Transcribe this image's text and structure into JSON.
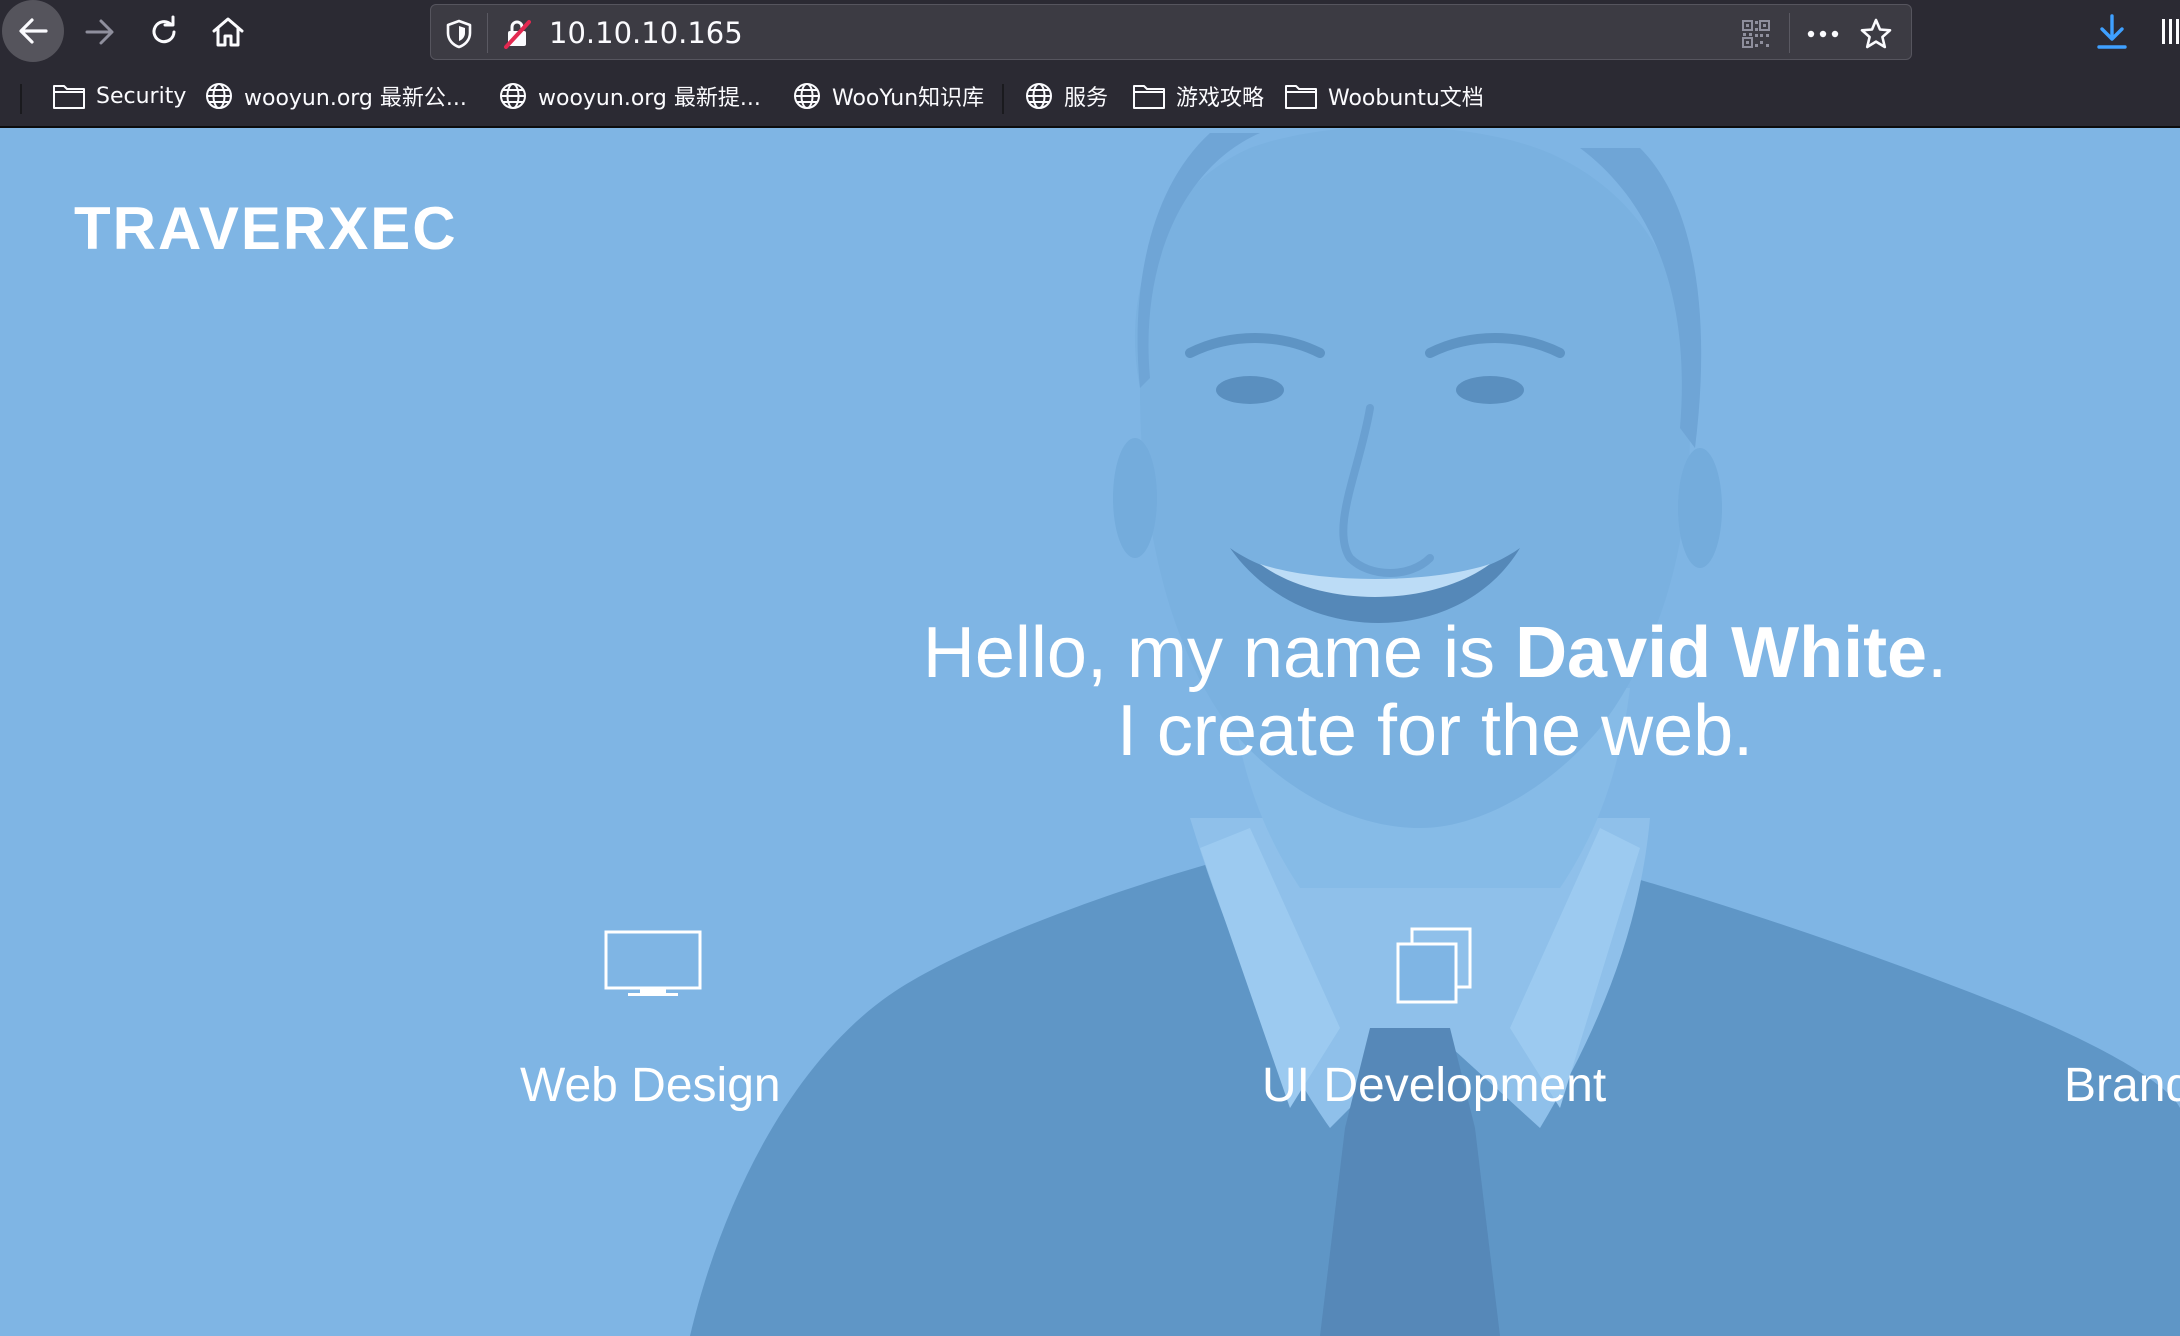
{
  "browser": {
    "url": "10.10.10.165",
    "icons": {
      "back": "back-arrow-icon",
      "forward": "forward-arrow-icon",
      "reload": "reload-icon",
      "home": "home-icon",
      "tracking": "shield-icon",
      "insecure": "insecure-lock-icon",
      "qr": "qr-code-icon",
      "more": "ellipsis-icon",
      "bookmark": "star-icon",
      "downloads": "download-icon",
      "library": "library-icon"
    },
    "bookmarks": [
      {
        "label": "Security",
        "icon": "folder-icon"
      },
      {
        "label": "wooyun.org 最新公...",
        "icon": "globe-icon"
      },
      {
        "label": "wooyun.org 最新提...",
        "icon": "globe-icon"
      },
      {
        "label": "WooYun知识库",
        "icon": "globe-icon"
      },
      {
        "label": "服务",
        "icon": "globe-icon"
      },
      {
        "label": "游戏攻略",
        "icon": "folder-icon"
      },
      {
        "label": "Woobuntu文档",
        "icon": "folder-icon"
      }
    ]
  },
  "site": {
    "brand": "TRAVERXEC",
    "headline": {
      "prefix": "Hello, my name is ",
      "name": "David White",
      "suffix": ".",
      "line2": "I create for the web."
    },
    "services": [
      {
        "label": "Web Design",
        "icon": "monitor-icon"
      },
      {
        "label": "UI Development",
        "icon": "stacked-windows-icon"
      },
      {
        "label": "Branding",
        "icon": ""
      }
    ],
    "colors": {
      "overlay": "#7fb5e4",
      "chrome": "#2b2a33",
      "text": "#ffffff"
    }
  }
}
